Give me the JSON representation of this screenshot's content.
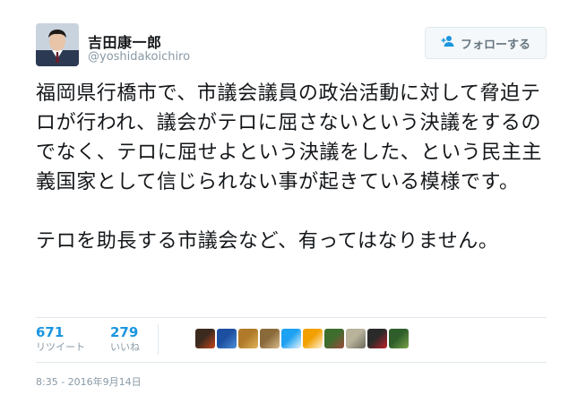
{
  "user": {
    "display_name": "吉田康一郎",
    "handle": "@yoshidakoichiro"
  },
  "follow_button": {
    "label": "フォローする",
    "icon": "add-user-icon"
  },
  "tweet": {
    "paragraph1": "福岡県行橋市で、市議会議員の政治活動に対して脅迫テロが行われ、議会がテロに屈さないという決議をするのでなく、テロに屈せよという決議をした、という民主主義国家として信じられない事が起きている模様です。",
    "paragraph2": "テロを助長する市議会など、有ってはなりません。"
  },
  "stats": {
    "retweets": {
      "count": "671",
      "label": "リツイート"
    },
    "likes": {
      "count": "279",
      "label": "いいね"
    }
  },
  "liker_avatars": [
    {
      "name": "liker-avatar-1",
      "colors": [
        "#3c2a1e",
        "#c8461c"
      ]
    },
    {
      "name": "liker-avatar-2",
      "colors": [
        "#1d4fa0",
        "#4d8ed6"
      ]
    },
    {
      "name": "liker-avatar-3",
      "colors": [
        "#b07a2a",
        "#e0b45a"
      ]
    },
    {
      "name": "liker-avatar-4",
      "colors": [
        "#8a6a3a",
        "#d7b98a"
      ]
    },
    {
      "name": "liker-avatar-5",
      "colors": [
        "#1da1f2",
        "#e8f4fb"
      ]
    },
    {
      "name": "liker-avatar-6",
      "colors": [
        "#f2a000",
        "#fdf2d9"
      ]
    },
    {
      "name": "liker-avatar-7",
      "colors": [
        "#3d6e2e",
        "#9c4a3a"
      ]
    },
    {
      "name": "liker-avatar-8",
      "colors": [
        "#b9b39c",
        "#6b6a5c"
      ]
    },
    {
      "name": "liker-avatar-9",
      "colors": [
        "#2a2a2a",
        "#c0202a"
      ]
    },
    {
      "name": "liker-avatar-10",
      "colors": [
        "#2f5e2a",
        "#7aa24a"
      ]
    }
  ],
  "timestamp": "8:35 - 2016年9月14日",
  "colors": {
    "accent": "#1b95e0",
    "muted": "#8899a6",
    "border": "#e1e8ed"
  }
}
